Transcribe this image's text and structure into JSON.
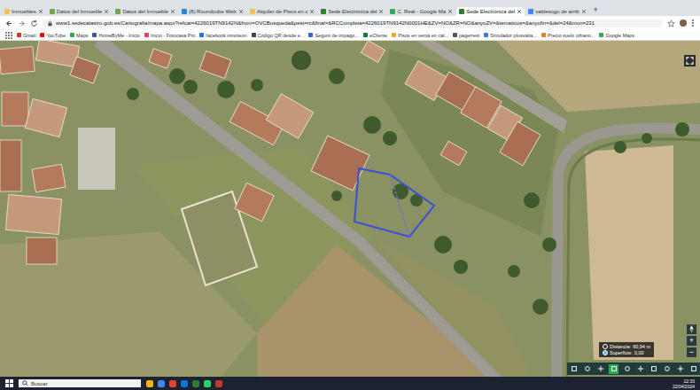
{
  "browser": {
    "tabs": [
      {
        "label": "Inmuebles",
        "selected": false
      },
      {
        "label": "Datos del Inmueble",
        "selected": false
      },
      {
        "label": "Datos del Inmueble",
        "selected": false
      },
      {
        "label": "(8) Roundcube Web",
        "selected": false
      },
      {
        "label": "Alquiler de Pisos en c",
        "selected": false
      },
      {
        "label": "Sede Electrónica del",
        "selected": false
      },
      {
        "label": "C. Real - Google Ma",
        "selected": false
      },
      {
        "label": "Sede Electrónica del",
        "selected": true
      },
      {
        "label": "valdesogo de arrib",
        "selected": false
      }
    ],
    "new_tab": "+",
    "url": "www1.sedecatastro.gob.es/Cartografia/mapa.aspx?refcat=4226019TN9142N&from=OVCBusqueda&pest=rc&final=&RCCompleta=4226019TN9142N0001HE&ZV=NO&ZR=NO&anyoZV=&tematicos=&anyofin=&del=24&mun=231",
    "bookmarks": [
      "Gmail",
      "YouTube",
      "Maps",
      "HomeByMe - Inicio",
      "Inicio - Fotocasa Pro",
      "facebook inmoleon",
      "Código QR desde e...",
      "Seguro de impago...",
      "eCliente",
      "Pisos en venta en cal...",
      "pagerrest",
      "Simulador plusvalía...",
      "Precio suelo urbano...",
      "Google Maps"
    ]
  },
  "map": {
    "zoom_in": "+",
    "zoom_out": "−",
    "measure": {
      "distance_label": "Distancia:",
      "distance": "60,94 m",
      "area_label": "Superficie:",
      "area": "0,00"
    },
    "tools": [
      {
        "selected": false
      },
      {
        "selected": false
      },
      {
        "selected": false
      },
      {
        "selected": true
      },
      {
        "selected": false
      },
      {
        "selected": false
      },
      {
        "selected": false
      },
      {
        "selected": false
      },
      {
        "selected": false
      },
      {
        "selected": false
      }
    ]
  },
  "taskbar": {
    "search_placeholder": "Buscar",
    "time": "12:33",
    "date": "22/04/2024"
  }
}
